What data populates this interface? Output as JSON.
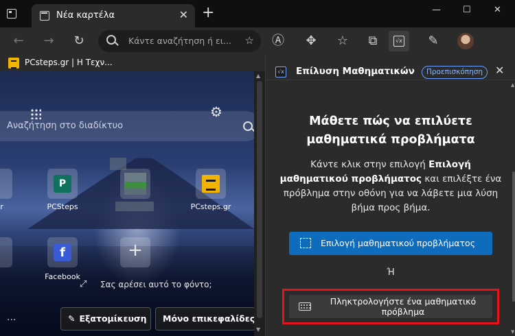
{
  "tab": {
    "title": "Νέα καρτέλα",
    "close": "✕"
  },
  "new_tab": "+",
  "window_controls": [
    "—",
    "☐",
    "✕"
  ],
  "address": {
    "placeholder": "Κάντε αναζήτηση ή ει..."
  },
  "favorites": [
    {
      "label": "PCsteps.gr | Η Τεχν..."
    }
  ],
  "newtab_page": {
    "search_placeholder": "Αναζήτηση στο διαδίκτυο",
    "tiles": [
      {
        "label": "gr"
      },
      {
        "label": "PCSteps"
      },
      {
        "label": ""
      },
      {
        "label": "PCsteps.gr"
      },
      {
        "label": ""
      },
      {
        "label": "Facebook"
      },
      {
        "label": ""
      }
    ],
    "background_prompt": "Σας αρέσει αυτό το φόντο;",
    "more": "···",
    "customize_button": "Εξατομίκευση",
    "headings_button": "Μόνο επικεφαλίδες"
  },
  "math_pane": {
    "title": "Επίλυση Μαθηματικών",
    "badge": "Προεπισκόπηση",
    "heading": "Μάθετε πώς να επιλύετε μαθηματικά προβλήματα",
    "body_pre": "Κάντε κλικ στην επιλογή ",
    "body_bold": "Επιλογή μαθηματικού προβλήματος",
    "body_post": " και επιλέξτε ένα πρόβλημα στην οθόνη για να λάβετε μια λύση βήμα προς βήμα.",
    "select_button": "Επιλογή μαθηματικού προβλήματος",
    "or": "Ή",
    "type_button": "Πληκτρολογήστε ένα μαθηματικό πρόβλημα"
  },
  "colors": {
    "accent": "#0f6cbd",
    "highlight": "#e8121c",
    "badge": "#6ca0ff"
  }
}
